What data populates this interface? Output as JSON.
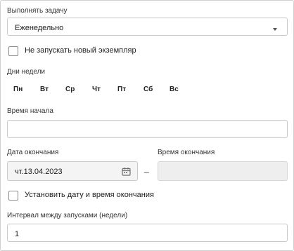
{
  "task": {
    "label": "Выполнять задачу",
    "selected": "Еженедельно"
  },
  "no_new_instance": {
    "label": "Не запускать новый экземпляр",
    "checked": false
  },
  "weekdays": {
    "label": "Дни недели",
    "days": [
      "Пн",
      "Вт",
      "Ср",
      "Чт",
      "Пт",
      "Сб",
      "Вс"
    ]
  },
  "start_time": {
    "label": "Время начала",
    "value": ""
  },
  "end_date": {
    "label": "Дата окончания",
    "value": "чт.13.04.2023"
  },
  "end_time": {
    "label": "Время окончания",
    "value": ""
  },
  "range_separator": "_",
  "set_end": {
    "label": "Установить дату и время окончания",
    "checked": false
  },
  "interval": {
    "label": "Интервал между запусками (недели)",
    "value": "1"
  }
}
